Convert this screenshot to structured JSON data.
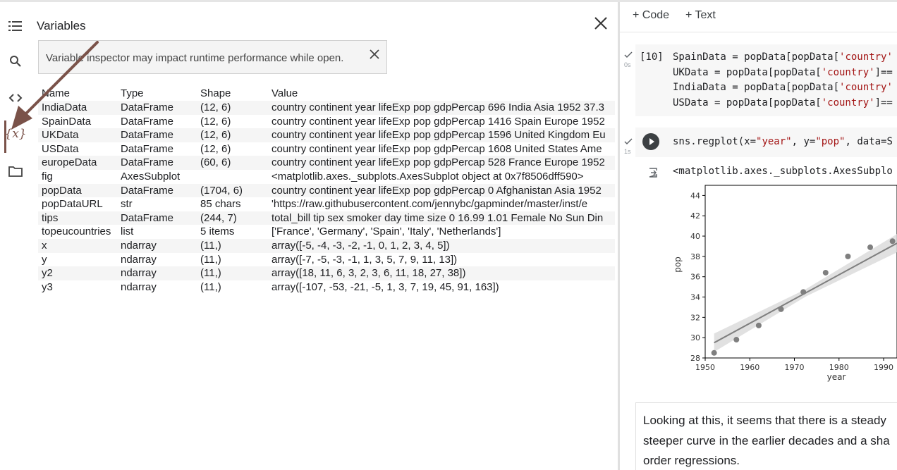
{
  "rail": {
    "icons": [
      "menu-icon",
      "search-icon",
      "code-icon",
      "variables-icon",
      "folder-icon"
    ],
    "variables_glyph": "{x}"
  },
  "panel": {
    "title": "Variables",
    "banner": "Variable inspector may impact runtime performance while open.",
    "headers": {
      "name": "Name",
      "type": "Type",
      "shape": "Shape",
      "value": "Value"
    },
    "rows": [
      {
        "name": "IndiaData",
        "type": "DataFrame",
        "shape": "(12, 6)",
        "value": "country continent year lifeExp pop gdpPercap 696 India Asia 1952 37.3"
      },
      {
        "name": "SpainData",
        "type": "DataFrame",
        "shape": "(12, 6)",
        "value": "country continent year lifeExp pop gdpPercap 1416 Spain Europe 1952"
      },
      {
        "name": "UKData",
        "type": "DataFrame",
        "shape": "(12, 6)",
        "value": "country continent year lifeExp pop gdpPercap 1596 United Kingdom Eu"
      },
      {
        "name": "USData",
        "type": "DataFrame",
        "shape": "(12, 6)",
        "value": "country continent year lifeExp pop gdpPercap 1608 United States Ame"
      },
      {
        "name": "europeData",
        "type": "DataFrame",
        "shape": "(60, 6)",
        "value": "country continent year lifeExp pop gdpPercap 528 France Europe 1952"
      },
      {
        "name": "fig",
        "type": "AxesSubplot",
        "shape": "",
        "value": "<matplotlib.axes._subplots.AxesSubplot object at 0x7f8506dff590>"
      },
      {
        "name": "popData",
        "type": "DataFrame",
        "shape": "(1704, 6)",
        "value": "country continent year lifeExp pop gdpPercap 0 Afghanistan Asia 1952"
      },
      {
        "name": "popDataURL",
        "type": "str",
        "shape": "85 chars",
        "value": "'https://raw.githubusercontent.com/jennybc/gapminder/master/inst/e"
      },
      {
        "name": "tips",
        "type": "DataFrame",
        "shape": "(244, 7)",
        "value": "total_bill tip sex smoker day time size 0 16.99 1.01 Female No Sun Din"
      },
      {
        "name": "topeucountries",
        "type": "list",
        "shape": "5 items",
        "value": "['France', 'Germany', 'Spain', 'Italy', 'Netherlands']"
      },
      {
        "name": "x",
        "type": "ndarray",
        "shape": "(11,)",
        "value": "array([-5, -4, -3, -2, -1, 0, 1, 2, 3, 4, 5])"
      },
      {
        "name": "y",
        "type": "ndarray",
        "shape": "(11,)",
        "value": "array([-7, -5, -3, -1, 1, 3, 5, 7, 9, 11, 13])"
      },
      {
        "name": "y2",
        "type": "ndarray",
        "shape": "(11,)",
        "value": "array([18, 11, 6, 3, 2, 3, 6, 11, 18, 27, 38])"
      },
      {
        "name": "y3",
        "type": "ndarray",
        "shape": "(11,)",
        "value": "array([-107, -53, -21, -5, 1, 3, 7, 19, 45, 91, 163])"
      }
    ]
  },
  "notebook": {
    "add_code": "+ Code",
    "add_text": "+ Text",
    "cell1": {
      "exec_count": "[10]",
      "status": "0s",
      "lines": [
        [
          "SpainData = popData[popData[",
          "'country'"
        ],
        [
          "UKData = popData[popData[",
          "'country'",
          "]=="
        ],
        [
          "IndiaData = popData[popData[",
          "'country'"
        ],
        [
          "USData = popData[popData[",
          "'country'",
          "]=="
        ]
      ]
    },
    "cell2": {
      "status": "1s",
      "code_prefix": "sns.regplot(x=",
      "code_x": "\"year\"",
      "code_mid": ", y=",
      "code_y": "\"pop\"",
      "code_end": ", data=S"
    },
    "output_text": "<matplotlib.axes._subplots.AxesSubplo",
    "text_cell": [
      "Looking at this, it seems that there is a steady",
      "steeper curve in the earlier decades and a sha",
      "order regressions."
    ]
  },
  "chart_data": {
    "type": "scatter",
    "xlabel": "year",
    "ylabel": "pop",
    "xlim": [
      1950,
      1993
    ],
    "ylim": [
      28,
      45
    ],
    "xticks": [
      1950,
      1960,
      1970,
      1980,
      1990
    ],
    "yticks": [
      28,
      30,
      32,
      34,
      36,
      38,
      40,
      42,
      44
    ],
    "points": [
      {
        "x": 1952,
        "y": 28.5
      },
      {
        "x": 1957,
        "y": 29.8
      },
      {
        "x": 1962,
        "y": 31.2
      },
      {
        "x": 1967,
        "y": 32.8
      },
      {
        "x": 1972,
        "y": 34.5
      },
      {
        "x": 1977,
        "y": 36.4
      },
      {
        "x": 1982,
        "y": 38.0
      },
      {
        "x": 1987,
        "y": 38.9
      },
      {
        "x": 1992,
        "y": 39.5
      }
    ],
    "regression": {
      "x1": 1952,
      "y1": 29.5,
      "x2": 1993,
      "y2": 39.3
    },
    "ci_band": {
      "width": 0.9
    },
    "colors": {
      "points": "#7f7f7f",
      "line": "#7f7f7f",
      "band": "#d9d9d9"
    }
  }
}
